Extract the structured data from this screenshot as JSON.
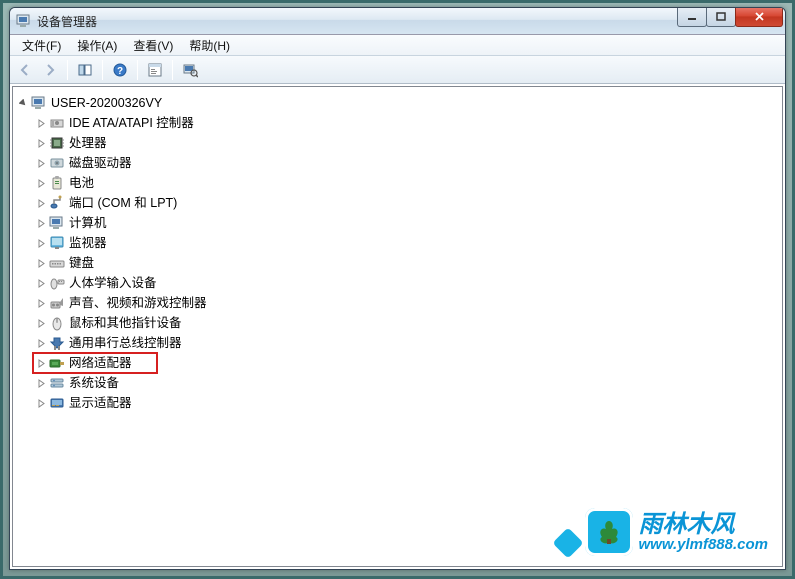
{
  "window": {
    "title": "设备管理器"
  },
  "menu": {
    "file": "文件(F)",
    "action": "操作(A)",
    "view": "查看(V)",
    "help": "帮助(H)"
  },
  "tree": {
    "root": "USER-20200326VY",
    "items": [
      "IDE ATA/ATAPI 控制器",
      "处理器",
      "磁盘驱动器",
      "电池",
      "端口 (COM 和 LPT)",
      "计算机",
      "监视器",
      "键盘",
      "人体学输入设备",
      "声音、视频和游戏控制器",
      "鼠标和其他指针设备",
      "通用串行总线控制器",
      "网络适配器",
      "系统设备",
      "显示适配器"
    ]
  },
  "watermark": {
    "cn": "雨林木风",
    "en": "www.ylmf888.com"
  },
  "highlighted_index": 12
}
